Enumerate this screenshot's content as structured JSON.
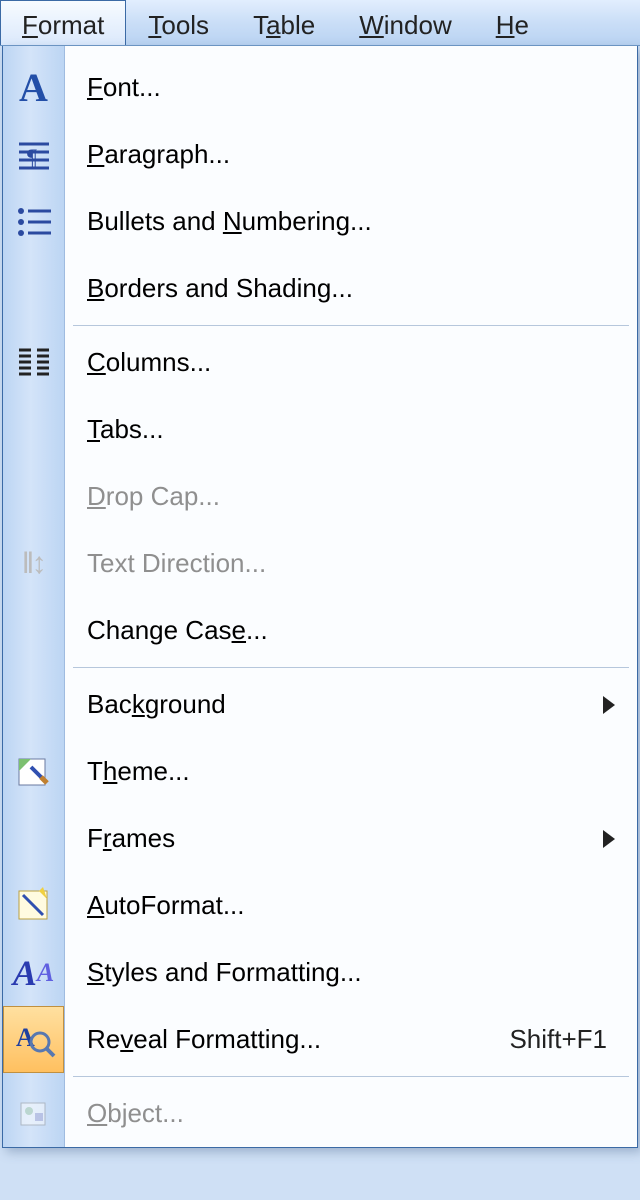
{
  "menubar": {
    "format": "Format",
    "tools": "Tools",
    "table": "Table",
    "window": "Window",
    "help": "He"
  },
  "menu": {
    "font": "Font...",
    "paragraph": "Paragraph...",
    "bullets": "Bullets and Numbering...",
    "borders": "Borders and Shading...",
    "columns": "Columns...",
    "tabs": "Tabs...",
    "dropcap": "Drop Cap...",
    "textdir": "Text Direction...",
    "changecase": "Change Case...",
    "background": "Background",
    "theme": "Theme...",
    "frames": "Frames",
    "autoformat": "AutoFormat...",
    "styles": "Styles and Formatting...",
    "reveal": "Reveal Formatting...",
    "reveal_shortcut": "Shift+F1",
    "object": "Object..."
  },
  "underline_pos": {
    "format": 1,
    "tools": 1,
    "table": 2,
    "window": 1,
    "help": 1,
    "font": 1,
    "paragraph": 1,
    "bullets": 13,
    "borders": 1,
    "columns": 1,
    "tabs": 1,
    "dropcap": 1,
    "textdir": 0,
    "changecase": 11,
    "background": 4,
    "theme": 2,
    "frames": 2,
    "autoformat": 1,
    "styles": 1,
    "reveal": 3,
    "object": 1
  }
}
